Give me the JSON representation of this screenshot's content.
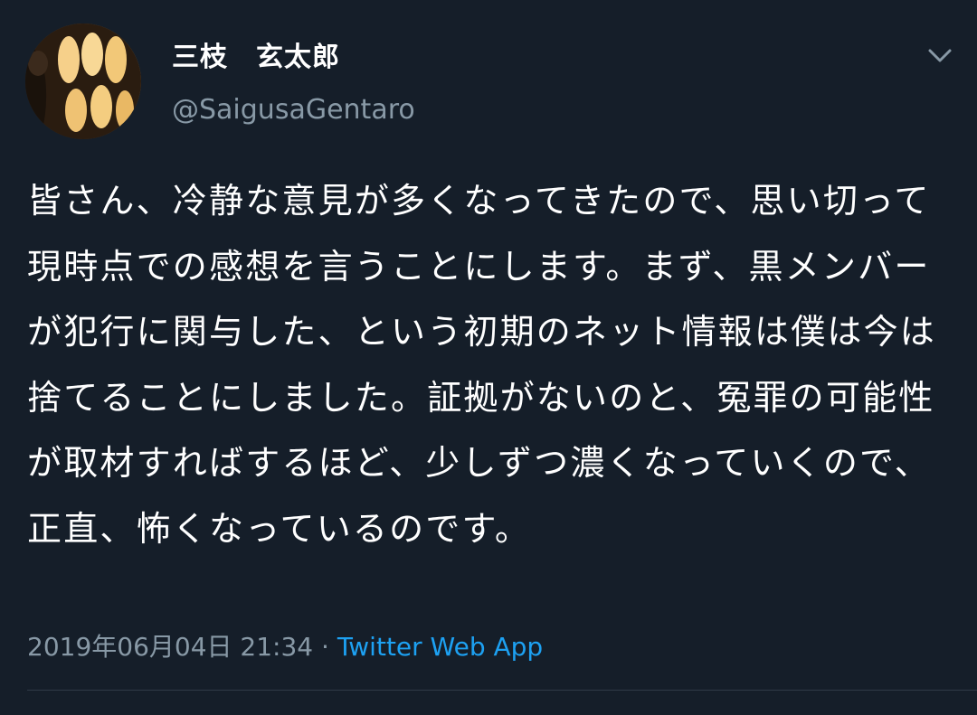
{
  "tweet": {
    "author": {
      "display_name": "三枝　玄太郎",
      "handle": "@SaigusaGentaro"
    },
    "text": "皆さん、冷静な意見が多くなってきたので、思い切って現時点での感想を言うことにします。まず、黒メンバーが犯行に関与した、という初期のネット情報は僕は今は捨てることにしました。証拠がないのと、冤罪の可能性が取材すればするほど、少しずつ濃くなっていくので、正直、怖くなっているのです。",
    "timestamp": "2019年06月04日 21:34",
    "separator": " · ",
    "source": "Twitter Web App"
  },
  "icons": {
    "menu": "chevron-down-icon",
    "avatar": "avatar"
  },
  "colors": {
    "background": "#151e29",
    "text": "#ffffff",
    "secondary": "#8899a6",
    "link": "#1da1f2"
  }
}
